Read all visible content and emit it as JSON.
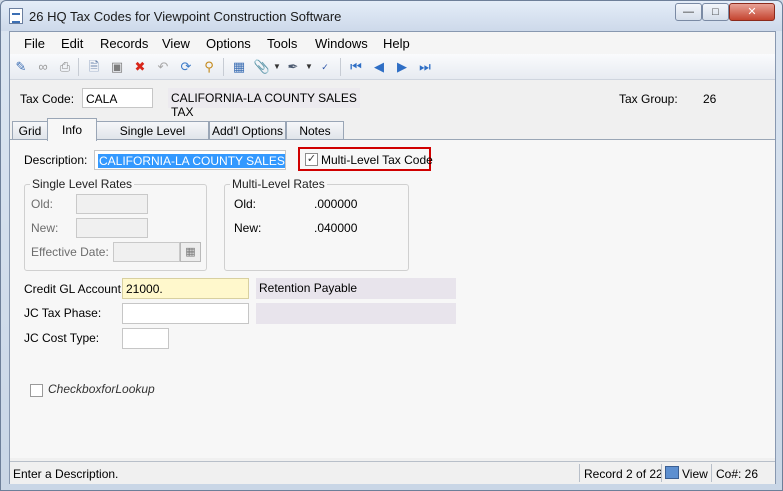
{
  "window": {
    "title": "26 HQ Tax Codes for Viewpoint Construction Software",
    "minimize_glyph": "—",
    "maximize_glyph": "□",
    "close_glyph": "✕"
  },
  "menu": {
    "items": [
      "File",
      "Edit",
      "Records",
      "View",
      "Options",
      "Tools",
      "Windows",
      "Help"
    ]
  },
  "toolbar": {
    "icons": [
      "new-record-icon",
      "link-icon",
      "printer-icon",
      "blank-page-icon",
      "save-icon",
      "delete-icon",
      "undo-icon",
      "refresh-icon",
      "search-icon",
      "calculator-icon",
      "attachment-icon",
      "edit-pen-icon",
      "spellcheck-icon",
      "first-record-icon",
      "previous-record-icon",
      "next-record-icon",
      "last-record-icon"
    ]
  },
  "header": {
    "tax_code_label": "Tax Code:",
    "tax_code_value": "CALA",
    "tax_code_description": "CALIFORNIA-LA COUNTY SALES TAX",
    "tax_group_label": "Tax Group:",
    "tax_group_value": "26"
  },
  "tabs": [
    {
      "label": "Grid",
      "active": false
    },
    {
      "label": "Info",
      "active": true
    },
    {
      "label": "Single Level Members",
      "active": false
    },
    {
      "label": "Add'l Options",
      "active": false
    },
    {
      "label": "Notes",
      "active": false
    }
  ],
  "info": {
    "description_label": "Description:",
    "description_value": "CALIFORNIA-LA COUNTY SALES TAX",
    "multi_level_label": "Multi-Level Tax Code",
    "multi_level_checked": true,
    "single_level": {
      "title": "Single Level Rates",
      "old_label": "Old:",
      "new_label": "New:",
      "effective_date_label": "Effective Date:"
    },
    "multi_level": {
      "title": "Multi-Level Rates",
      "old_label": "Old:",
      "old_value": ".000000",
      "new_label": "New:",
      "new_value": ".040000"
    },
    "credit_gl_label": "Credit GL Account:",
    "credit_gl_value": "21000.",
    "credit_gl_description": "Retention Payable",
    "jc_tax_phase_label": "JC Tax Phase:",
    "jc_tax_phase_value": "",
    "jc_cost_type_label": "JC Cost Type:",
    "jc_cost_type_value": "",
    "lookup_checkbox_label": "CheckboxforLookup",
    "lookup_checked": false
  },
  "status": {
    "message": "Enter a Description.",
    "record": "Record 2 of 22",
    "mode": "View",
    "company": "Co#: 26"
  },
  "colors": {
    "highlight": "#d00000",
    "gl_field": "#fff8cc",
    "selection": "#3399ff"
  }
}
